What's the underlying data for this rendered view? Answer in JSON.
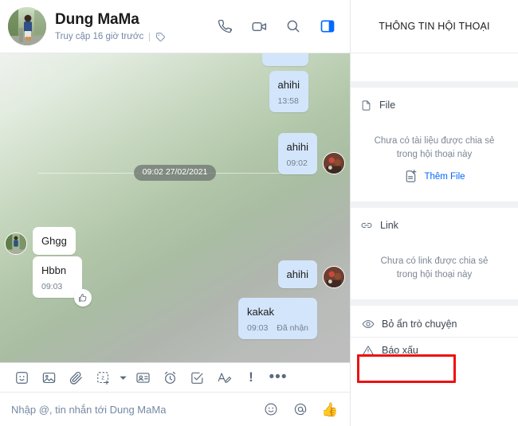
{
  "header": {
    "peer_name": "Dung MaMa",
    "status_text": "Truy cập 16 giờ trước",
    "tag_icon": "tag-icon",
    "actions": [
      {
        "name": "call-icon",
        "label": "Gọi thoại"
      },
      {
        "name": "video-call-icon",
        "label": "Gọi video"
      },
      {
        "name": "search-icon",
        "label": "Tìm kiếm"
      },
      {
        "name": "toggle-info-panel-icon",
        "label": "Thông tin hội thoại",
        "color": "#0068ff"
      }
    ]
  },
  "conversation": {
    "date_divider": "09:02 27/02/2021",
    "messages": [
      {
        "id": "m0",
        "side": "out",
        "text": "",
        "time": "",
        "partial": true
      },
      {
        "id": "m1",
        "side": "out",
        "text": "ahihi",
        "time": "13:58"
      },
      {
        "id": "m2",
        "side": "out",
        "text": "ahihi",
        "time": "09:02",
        "avatar": true
      },
      {
        "id": "m3",
        "side": "in",
        "text": "Ghgg",
        "time": "",
        "avatar": true
      },
      {
        "id": "m4",
        "side": "in",
        "text": "Hbbn",
        "time": "09:03",
        "reaction": "👍"
      },
      {
        "id": "m5",
        "side": "out",
        "text": "ahihi",
        "time": "",
        "avatar": true
      },
      {
        "id": "m6",
        "side": "out",
        "text": "kakak",
        "time": "09:03",
        "status": "Đã nhận"
      }
    ]
  },
  "composer": {
    "placeholder": "Nhập @, tin nhắn tới Dung MaMa",
    "toolbar": [
      {
        "name": "sticker-icon",
        "label": "Sticker"
      },
      {
        "name": "image-icon",
        "label": "Hình ảnh"
      },
      {
        "name": "attachment-icon",
        "label": "Đính kèm"
      },
      {
        "name": "screen-capture-icon",
        "label": "Chụp màn hình"
      },
      {
        "name": "chevron-down-icon",
        "label": "Thêm"
      },
      {
        "name": "business-card-icon",
        "label": "Danh thiếp"
      },
      {
        "name": "reminder-icon",
        "label": "Nhắc hẹn"
      },
      {
        "name": "todo-icon",
        "label": "Việc cần làm"
      },
      {
        "name": "text-format-icon",
        "label": "Định dạng"
      },
      {
        "name": "priority-icon",
        "label": "Tin quan trọng"
      },
      {
        "name": "more-icon",
        "label": "Tùy chọn khác"
      }
    ],
    "input_actions": [
      {
        "name": "emoji-icon",
        "label": "Biểu cảm"
      },
      {
        "name": "mention-icon",
        "label": "Nhắc đến"
      },
      {
        "name": "thumbs-up-icon",
        "label": "Gửi like"
      }
    ]
  },
  "info_panel": {
    "title": "THÔNG TIN HỘI THOẠI",
    "file_section": {
      "icon": "file-icon",
      "label": "File",
      "empty_line1": "Chưa có tài liệu được chia sẻ",
      "empty_line2": "trong hội thoại này",
      "add_label": "Thêm File",
      "add_icon": "add-file-icon",
      "add_color": "#0068ff"
    },
    "link_section": {
      "icon": "link-icon",
      "label": "Link",
      "empty_line1": "Chưa có link được chia sẻ",
      "empty_line2": "trong hội thoại này"
    },
    "actions": [
      {
        "name": "unhide-conversation",
        "icon": "eye-icon",
        "label": "Bỏ ẩn trò chuyện",
        "highlighted": true
      },
      {
        "name": "report-conversation",
        "icon": "warning-icon",
        "label": "Báo xấu",
        "highlighted": false
      }
    ]
  },
  "annotation": {
    "highlight_color": "#ee1111",
    "target": "Bỏ ẩn trò chuyện"
  }
}
